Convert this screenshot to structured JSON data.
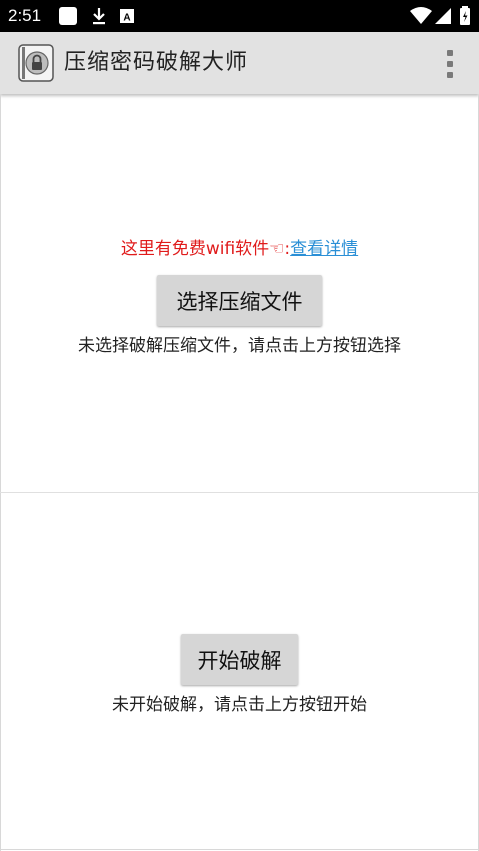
{
  "status_bar": {
    "time": "2:51",
    "icons": [
      "app-notification-icon",
      "download-icon",
      "keyboard-a-icon",
      "wifi-icon",
      "signal-icon",
      "battery-icon"
    ]
  },
  "app_bar": {
    "title": "压缩密码破解大师",
    "logo_icon": "zip-lock-icon",
    "menu_icon": "overflow-menu-icon"
  },
  "section_file": {
    "promo_text": "这里有免费wifi软件☜:",
    "promo_link": "查看详情",
    "select_button": "选择压缩文件",
    "status": "未选择破解压缩文件，请点击上方按钮选择"
  },
  "section_crack": {
    "start_button": "开始破解",
    "status": "未开始破解，请点击上方按钮开始"
  },
  "colors": {
    "promo_red": "#e01b1b",
    "link_blue": "#2a8fd6",
    "button_gray": "#d6d6d6",
    "app_bar_gray": "#e2e2e2"
  }
}
